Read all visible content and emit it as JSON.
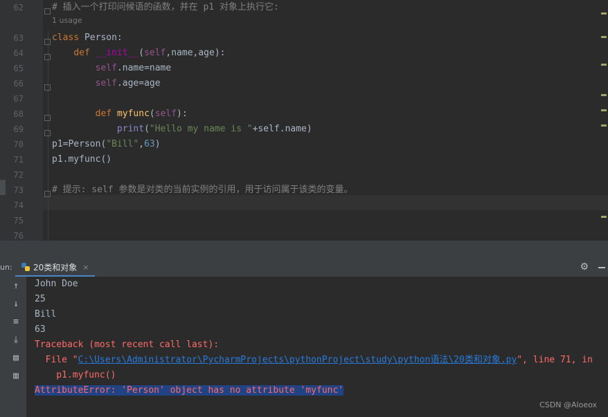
{
  "editor": {
    "lines": [
      {
        "no": "62",
        "tokens": [
          {
            "t": "# 插入一个打印问候语的函数，并在 p1 对象上执行它:",
            "c": "cmt"
          }
        ]
      },
      {
        "no": "63",
        "tokens": [
          {
            "t": "class ",
            "c": "kw"
          },
          {
            "t": "Person:",
            "c": ""
          }
        ]
      },
      {
        "no": "64",
        "tokens": [
          {
            "t": "    "
          },
          {
            "t": "def ",
            "c": "kw"
          },
          {
            "t": "__init__",
            "c": "dunder"
          },
          {
            "t": "(",
            "c": ""
          },
          {
            "t": "self",
            "c": "self"
          },
          {
            "t": ",name,age):",
            "c": ""
          }
        ]
      },
      {
        "no": "65",
        "tokens": [
          {
            "t": "        "
          },
          {
            "t": "self",
            "c": "self"
          },
          {
            "t": ".name=name",
            "c": ""
          }
        ]
      },
      {
        "no": "66",
        "tokens": [
          {
            "t": "        "
          },
          {
            "t": "self",
            "c": "self"
          },
          {
            "t": ".age=age",
            "c": ""
          }
        ]
      },
      {
        "no": "67",
        "tokens": []
      },
      {
        "no": "68",
        "tokens": [
          {
            "t": "        "
          },
          {
            "t": "def ",
            "c": "kw"
          },
          {
            "t": "myfunc",
            "c": "fn"
          },
          {
            "t": "(",
            "c": ""
          },
          {
            "t": "self",
            "c": "self"
          },
          {
            "t": "):",
            "c": ""
          }
        ]
      },
      {
        "no": "69",
        "tokens": [
          {
            "t": "            "
          },
          {
            "t": "print",
            "c": "builtin"
          },
          {
            "t": "(",
            "c": ""
          },
          {
            "t": "\"Hello my name is \"",
            "c": "str"
          },
          {
            "t": "+self.name)",
            "c": ""
          }
        ]
      },
      {
        "no": "70",
        "tokens": [
          {
            "t": "p1=Person(",
            "c": ""
          },
          {
            "t": "\"Bill\"",
            "c": "str"
          },
          {
            "t": ",",
            "c": ""
          },
          {
            "t": "63",
            "c": "num"
          },
          {
            "t": ")",
            "c": ""
          }
        ]
      },
      {
        "no": "71",
        "tokens": [
          {
            "t": "p1.myfunc()",
            "c": ""
          }
        ]
      },
      {
        "no": "72",
        "tokens": []
      },
      {
        "no": "73",
        "tokens": [
          {
            "t": "# 提示: self 参数是对类的当前实例的引用，用于访问属于该类的变量。",
            "c": "cmt"
          }
        ]
      },
      {
        "no": "74",
        "tokens": []
      },
      {
        "no": "75",
        "tokens": []
      },
      {
        "no": "76",
        "tokens": []
      }
    ],
    "usage_hint": "1 usage"
  },
  "run_panel": {
    "run_label": "un:",
    "tab_label": "20类和对象",
    "tab_close": "×"
  },
  "console": {
    "lines": [
      {
        "t": "John Doe",
        "c": ""
      },
      {
        "t": "25",
        "c": ""
      },
      {
        "t": "Bill",
        "c": ""
      },
      {
        "t": "63",
        "c": ""
      },
      {
        "t": "Traceback (most recent call last):",
        "c": "err"
      }
    ],
    "file_prefix": "  File \"",
    "file_path": "C:\\Users\\Administrator\\PycharmProjects\\pythonProject\\study\\python语法\\20类和对象.py",
    "file_suffix": "\", line 71, in",
    "call_line": "    p1.myfunc()",
    "error_line": "AttributeError: 'Person' object has no attribute 'myfunc'"
  },
  "watermark": "CSDN @Aloeox",
  "icons": [
    "arrow-up-icon",
    "arrow-down-icon",
    "soft-wrap-icon",
    "scroll-end-icon",
    "print-icon",
    "trash-icon",
    "gear-icon",
    "python-icon"
  ]
}
